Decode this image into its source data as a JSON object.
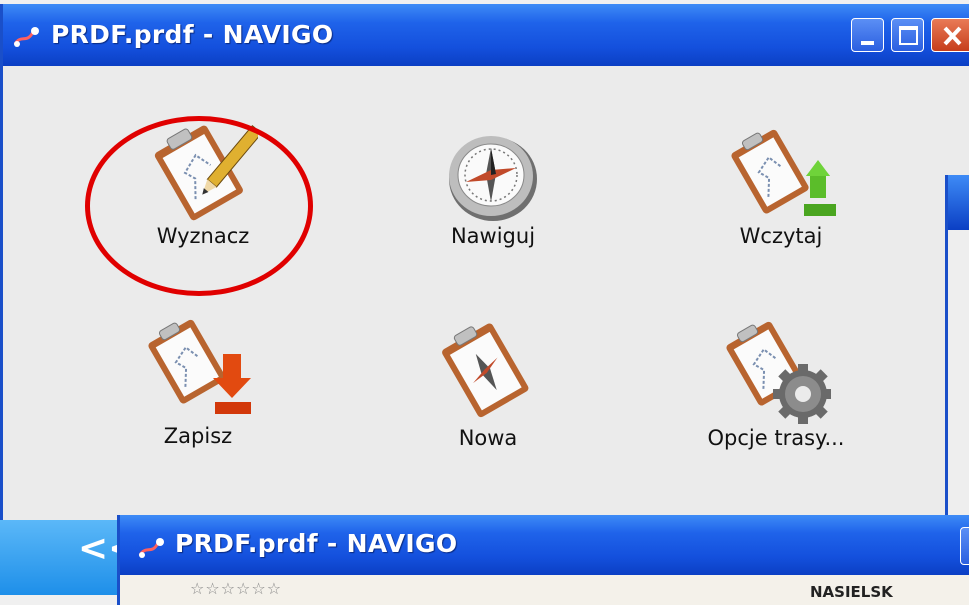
{
  "window": {
    "title": "PRDF.prdf - NAVIGO",
    "controls": {
      "minimize": "minimize",
      "maximize": "maximize",
      "close": "close"
    }
  },
  "menu": {
    "tiles": [
      {
        "label": "Wyznacz",
        "icon": "clipboard-pencil-icon",
        "highlighted": true
      },
      {
        "label": "Nawiguj",
        "icon": "compass-icon"
      },
      {
        "label": "Wczytaj",
        "icon": "clipboard-upload-icon"
      },
      {
        "label": "Zapisz",
        "icon": "clipboard-download-icon"
      },
      {
        "label": "Nowa",
        "icon": "clipboard-new-icon"
      },
      {
        "label": "Opcje trasy...",
        "icon": "clipboard-gear-icon"
      }
    ]
  },
  "back_button": {
    "glyph": "<<"
  },
  "second_window": {
    "title": "PRDF.prdf - NAVIGO",
    "map": {
      "place_label": "NASIELSK",
      "rating_stars": "☆☆☆☆☆☆"
    }
  },
  "colors": {
    "titlebar": "#1450dd",
    "highlight_ring": "#e00000",
    "back_button": "#1e8fe9",
    "arrow_green": "#5bbd2a",
    "arrow_red": "#e24a10"
  }
}
